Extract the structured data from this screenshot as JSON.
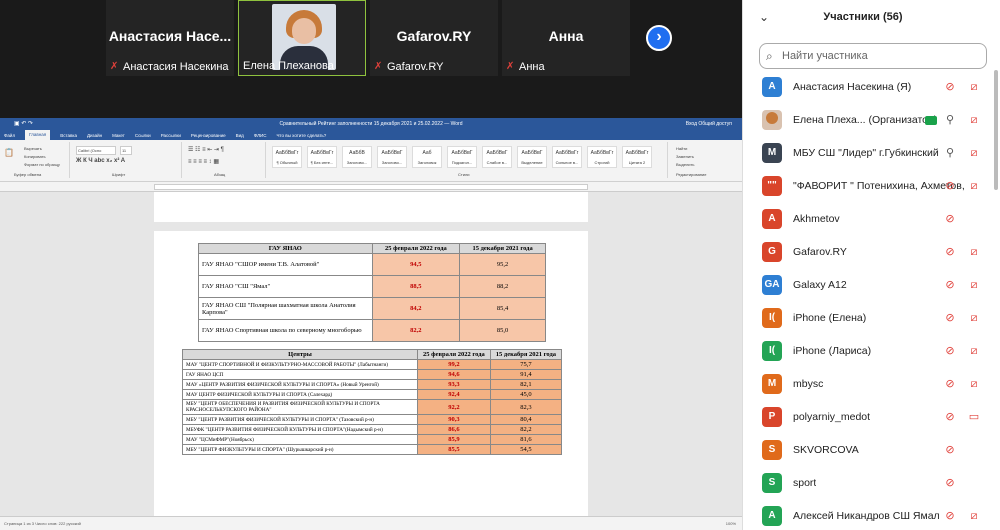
{
  "video_tiles": [
    {
      "big": "Анастасия  Насе...",
      "label": "Анастасия Насекина",
      "muted": true
    },
    {
      "big": "",
      "label": "Елена Плеханова",
      "muted": false,
      "active": true
    },
    {
      "big": "Gafarov.RY",
      "label": "Gafarov.RY",
      "muted": true
    },
    {
      "big": "Анна",
      "label": "Анна",
      "muted": true
    }
  ],
  "next_icon": "chevron-right-icon",
  "word": {
    "title": "Сравнительный Рейтинг заполненности 15 декабря 2021 и 25.02.2022 — Word",
    "title_right": "Вход   Общий доступ",
    "tabs": [
      "Файл",
      "Главная",
      "Вставка",
      "Дизайн",
      "Макет",
      "Ссылки",
      "Рассылки",
      "Рецензирование",
      "Вид",
      "ФЛИС",
      "Что вы хотите сделать?"
    ],
    "font_name": "Calibri (Осно",
    "font_size": "11",
    "styles": [
      "АаБбВвГг",
      "АаБбВвГг",
      "АаБбВ",
      "АаБбВвГ",
      "Ааб",
      "АаБбВвГ",
      "АаБбВвГ",
      "АаБбВвГ",
      "АаБбВвГг",
      "АаБбВвГг",
      "АаБбВвГг"
    ],
    "style_names": [
      "¶ Обычный",
      "¶ Без инте...",
      "Заголово...",
      "Заголово...",
      "Заголовок",
      "Подзагол...",
      "Слабое в...",
      "Выделение",
      "Сильное в...",
      "Строгий",
      "Цитата 2"
    ],
    "clipboard": [
      "Вырезать",
      "Копировать",
      "Формат по образцу"
    ],
    "groups": [
      "Буфер обмена",
      "Шрифт",
      "Абзац",
      "Стили",
      "Редактирование"
    ],
    "edit": [
      "Найти",
      "Заменить",
      "Выделить"
    ],
    "status": "Страница 1 из 3    Число слов: 222    русский",
    "zoom": "100%"
  },
  "table1": {
    "headers": [
      "ГАУ ЯНАО",
      "25 февраля 2022 года",
      "15 декабря 2021 года"
    ],
    "rows": [
      [
        "ГАУ ЯНАО \"СШОР имени Т.В. Алатовой\"",
        "94,5",
        "95,2"
      ],
      [
        "ГАУ ЯНАО \"СШ \"Ямал\"",
        "88,5",
        "88,2"
      ],
      [
        "ГАУ ЯНАО СШ \"Полярная шахматная школа Анатолия Карпова\"",
        "84,2",
        "85,4"
      ],
      [
        "ГАУ ЯНАО Спортивная школа по северному многоборью",
        "82,2",
        "85,0"
      ]
    ]
  },
  "table2": {
    "headers": [
      "Центры",
      "25 февраля 2022 года",
      "15 декабря 2021 года"
    ],
    "rows": [
      [
        "МАУ \"ЦЕНТР СПОРТИВНОЙ И ФИЗКУЛЬТУРНО-МАССОВОЙ РАБОТЫ\" (Лабытнанги)",
        "99,2",
        "75,7"
      ],
      [
        "ГАУ ЯНАО ЦСП",
        "94,6",
        "91,4"
      ],
      [
        "МАУ «ЦЕНТР РАЗВИТИЯ ФИЗИЧЕСКОЙ КУЛЬТУРЫ И СПОРТА» (Новый Уренгой)",
        "93,3",
        "82,1"
      ],
      [
        "МАУ ЦЕНТР ФИЗИЧЕСКОЙ КУЛЬТУРЫ И СПОРТА (Салехард)",
        "92,4",
        "45,0"
      ],
      [
        "МБУ \"ЦЕНТР ОБЕСПЕЧЕНИЯ И РАЗВИТИЯ ФИЗИЧЕСКОЙ КУЛЬТУРЫ И СПОРТА КРАСНОСЕЛЬКУПСКОГО РАЙОНА\"",
        "92,2",
        "82,3"
      ],
      [
        "МБУ \"ЦЕНТР РАЗВИТИЯ ФИЗИЧЕСКОЙ КУЛЬТУРЫ И СПОРТА\" (Тазовский р-н)",
        "90,3",
        "80,4"
      ],
      [
        "МБУФК \"ЦЕНТР РАЗВИТИЯ ФИЗИЧЕСКОЙ КУЛЬТУРЫ И СПОРТА\"(Надымский р-н)",
        "86,6",
        "82,2"
      ],
      [
        "МАУ \"ЦСМиФМР\"(Ноябрьск)",
        "85,9",
        "81,6"
      ],
      [
        "МБУ \"ЦЕНТР ФИЗКУЛЬТУРЫ И СПОРТА\" (Шурышкарский р-н)",
        "85,5",
        "54,5"
      ]
    ]
  },
  "participants_panel": {
    "title": "Участники (56)",
    "search_placeholder": "Найти участника",
    "items": [
      {
        "initials": "А",
        "color": "#2e7fd3",
        "name": "Анастасия Насекина (Я)",
        "mic": "off",
        "cam": "off"
      },
      {
        "initials": "",
        "color": "#d9c2b0",
        "name": "Елена Плеха...  (Организатор)",
        "mic": "on",
        "cam": "off",
        "photo": true,
        "badge": true
      },
      {
        "initials": "М",
        "color": "#3a4452",
        "name": "МБУ СШ \"Лидер\" г.Губкинский",
        "mic": "on",
        "cam": "off"
      },
      {
        "initials": "\"\"",
        "color": "#d9452b",
        "name": "\"ФАВОРИТ \" Потенихина, Ахметов, ...",
        "mic": "off",
        "cam": "off"
      },
      {
        "initials": "A",
        "color": "#d9452b",
        "name": "Akhmetov",
        "mic": "off",
        "cam": ""
      },
      {
        "initials": "G",
        "color": "#d9452b",
        "name": "Gafarov.RY",
        "mic": "off",
        "cam": "off"
      },
      {
        "initials": "GA",
        "color": "#2e7fd3",
        "name": "Galaxy A12",
        "mic": "off",
        "cam": "off"
      },
      {
        "initials": "I(",
        "color": "#e06a1b",
        "name": "iPhone (Елена)",
        "mic": "off",
        "cam": "off"
      },
      {
        "initials": "I(",
        "color": "#23a455",
        "name": "iPhone (Лариса)",
        "mic": "off",
        "cam": "off"
      },
      {
        "initials": "M",
        "color": "#e06a1b",
        "name": "mbysc",
        "mic": "off",
        "cam": "off"
      },
      {
        "initials": "P",
        "color": "#d9452b",
        "name": "polyarniy_medot",
        "mic": "off",
        "cam": "camera"
      },
      {
        "initials": "S",
        "color": "#e06a1b",
        "name": "SKVORCOVA",
        "mic": "off",
        "cam": ""
      },
      {
        "initials": "S",
        "color": "#23a455",
        "name": "sport",
        "mic": "off",
        "cam": ""
      },
      {
        "initials": "А",
        "color": "#23a455",
        "name": "Алексей Никандров СШ Ямал",
        "mic": "off",
        "cam": "off"
      }
    ]
  },
  "colors": {
    "accent": "#2b579a",
    "muted_red": "#e0403a",
    "zoom_blue": "#1f6ef0"
  }
}
